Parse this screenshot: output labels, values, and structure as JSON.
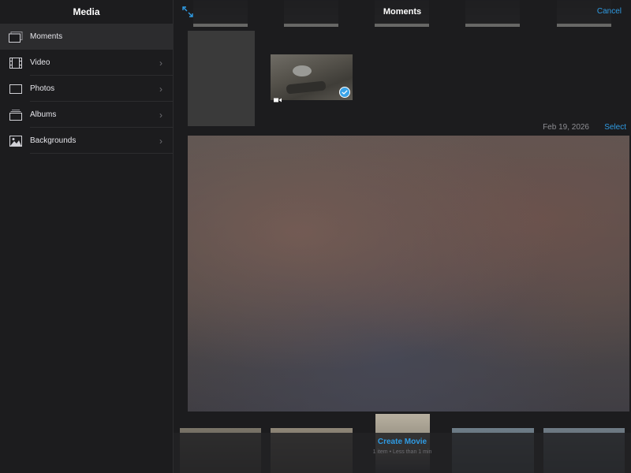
{
  "sidebar": {
    "title": "Media",
    "items": [
      {
        "label": "Moments",
        "icon": "moments-icon",
        "selected": true,
        "chevron": false
      },
      {
        "label": "Video",
        "icon": "film-icon",
        "selected": false,
        "chevron": true
      },
      {
        "label": "Photos",
        "icon": "photo-frame-icon",
        "selected": false,
        "chevron": true
      },
      {
        "label": "Albums",
        "icon": "album-stack-icon",
        "selected": false,
        "chevron": true
      },
      {
        "label": "Backgrounds",
        "icon": "landscape-icon",
        "selected": false,
        "chevron": true
      }
    ]
  },
  "header": {
    "title": "Moments",
    "cancel_label": "Cancel",
    "expand_icon": "expand-arrows-icon"
  },
  "moment": {
    "date": "Feb 19, 2026",
    "select_label": "Select"
  },
  "video_thumb": {
    "icon": "video-camera-icon",
    "selected_icon": "checkmark-icon",
    "selected": true
  },
  "footer": {
    "create_label": "Create Movie",
    "summary": "1 item • Less than 1 min"
  },
  "colors": {
    "accent": "#2f9be3",
    "background": "#1c1c1e",
    "selected_row": "#2c2c2e",
    "check": "#3aa3e8"
  }
}
